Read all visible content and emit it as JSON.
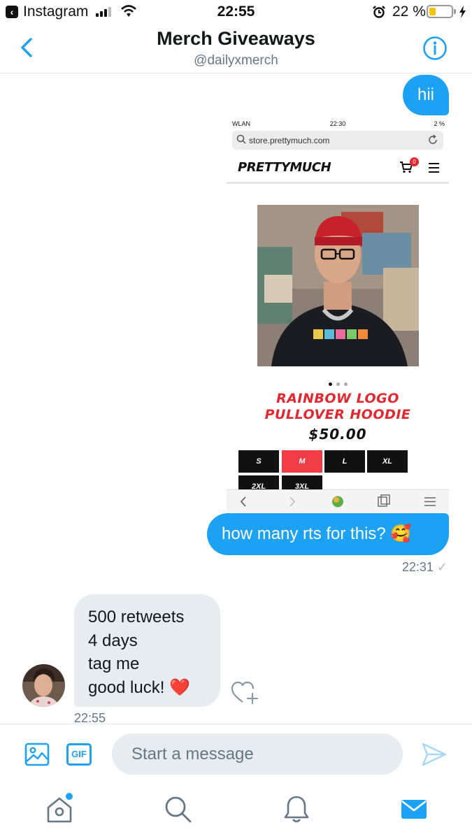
{
  "status_bar": {
    "back_app": "Instagram",
    "time": "22:55",
    "battery_pct": "22 %"
  },
  "header": {
    "title": "Merch Giveaways",
    "handle": "@dailyxmerch"
  },
  "messages": {
    "sent_1": "hii",
    "sent_2": "how many rts for this? 🥰",
    "sent_timestamp": "22:31",
    "received_lines": [
      "500 retweets",
      "4 days",
      "tag me",
      "good luck! ❤️"
    ],
    "received_timestamp": "22:55"
  },
  "embedded_screenshot": {
    "status_left": "WLAN",
    "status_time": "22:30",
    "status_right": "2 %",
    "url": "store.prettymuch.com",
    "logo": "PRETTYMUCH",
    "cart_count": "0",
    "product_name_line1": "RAINBOW LOGO",
    "product_name_line2": "PULLOVER HOODIE",
    "price": "$50.00",
    "sizes": [
      "S",
      "M",
      "L",
      "XL",
      "2XL",
      "3XL"
    ],
    "selected_size": "M"
  },
  "composer": {
    "placeholder": "Start a message",
    "gif_label": "GIF"
  },
  "icons": {
    "back": "chevron-left-icon",
    "info": "info-icon",
    "like": "heart-plus-icon",
    "media": "image-icon",
    "send": "send-icon",
    "home": "home-icon",
    "search": "search-icon",
    "notifications": "bell-icon",
    "messages": "mail-icon"
  },
  "colors": {
    "accent": "#1da1f2",
    "bubble_received": "#e6ecf0",
    "muted_text": "#657786",
    "product_red": "#e4262f"
  }
}
